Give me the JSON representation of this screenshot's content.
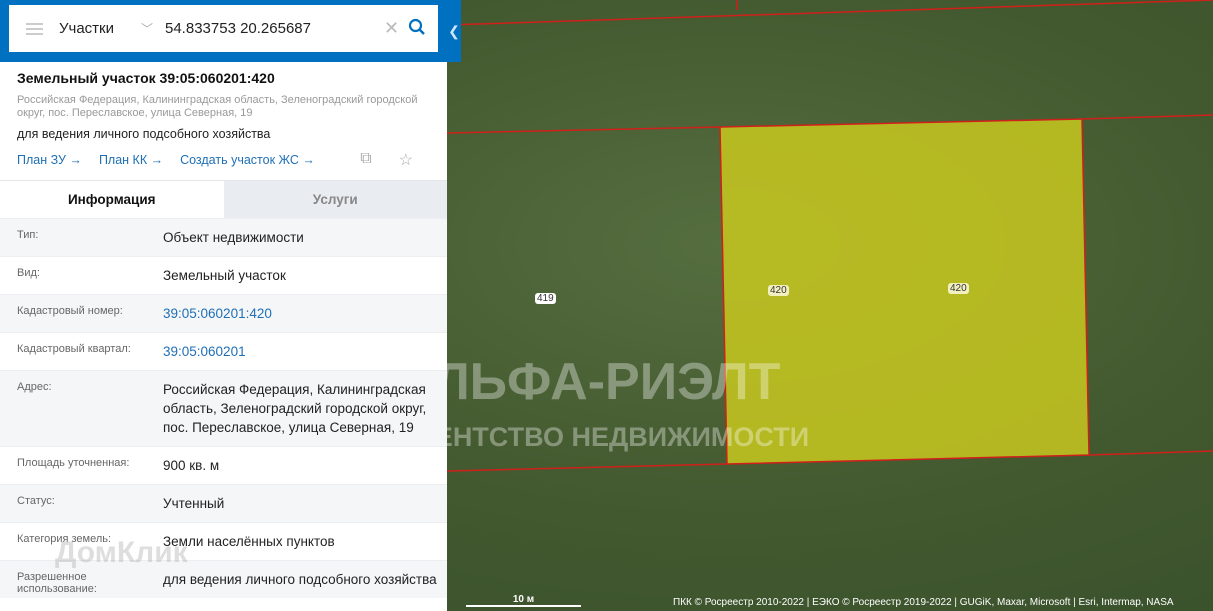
{
  "search": {
    "category": "Участки",
    "query": "54.833753 20.265687"
  },
  "object": {
    "title": "Земельный участок 39:05:060201:420",
    "address": "Российская Федерация, Калининградская область, Зеленоградский городской округ, пос. Переславское, улица Северная, 19",
    "purpose": "для ведения личного подсобного хозяйства",
    "links": [
      "План ЗУ →",
      "План КК →",
      "Создать участок ЖС →"
    ]
  },
  "tabs": [
    {
      "label": "Информация",
      "active": true
    },
    {
      "label": "Услуги",
      "active": false
    }
  ],
  "info": [
    {
      "k": "Тип:",
      "v": "Объект недвижимости"
    },
    {
      "k": "Вид:",
      "v": "Земельный участок"
    },
    {
      "k": "Кадастровый номер:",
      "v": "39:05:060201:420",
      "link": true
    },
    {
      "k": "Кадастровый квартал:",
      "v": "39:05:060201",
      "link": true
    },
    {
      "k": "Адрес:",
      "v": "Российская Федерация, Калининградская область, Зеленоградский городской округ, пос. Переславское, улица Северная, 19"
    },
    {
      "k": "Площадь уточненная:",
      "v": "900 кв. м"
    },
    {
      "k": "Статус:",
      "v": "Учтенный"
    },
    {
      "k": "Категория земель:",
      "v": "Земли населённых пунктов"
    },
    {
      "k": "Разрешенное использование:",
      "v": "для ведения личного подсобного хозяйства"
    }
  ],
  "map": {
    "labels": {
      "neighbor": "419",
      "parcel_a": "420",
      "parcel_b": "420"
    },
    "scale": "10 м",
    "attribution": "ПКК © Росреестр 2010-2022 | ЕЭКО © Росреестр 2019-2022 | GUGiK, Maxar, Microsoft | Esri, Intermap, NASA",
    "parcel_color": "#c8c81e",
    "boundary_color": "#d0201a"
  },
  "watermark": {
    "brand": "АЛЬФА-РИЭЛТ",
    "tagline": "АГЕНТСТВО НЕДВИЖИМОСТИ",
    "domclick": "ДомКлик"
  }
}
